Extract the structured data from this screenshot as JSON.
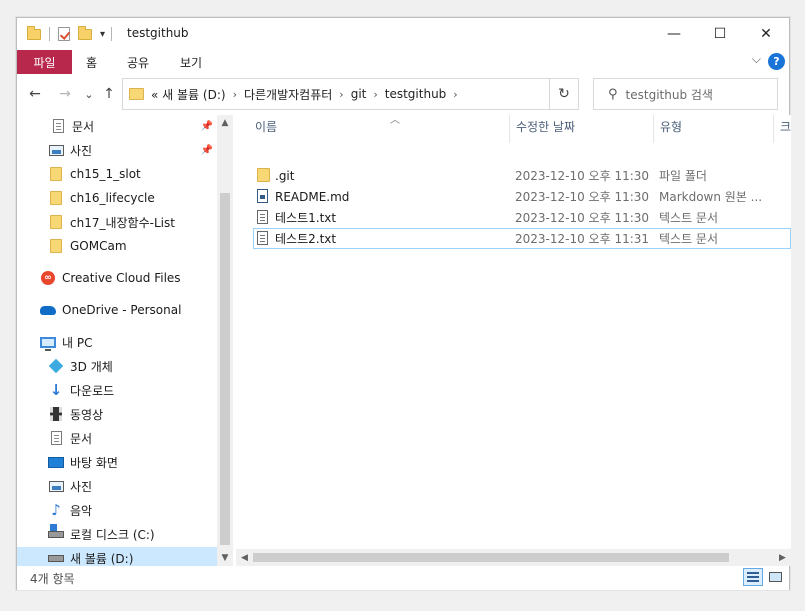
{
  "window": {
    "title": "testgithub",
    "controls": {
      "minimize": "—",
      "maximize": "☐",
      "close": "✕"
    }
  },
  "ribbon": {
    "file_tab": "파일",
    "tabs": [
      "홈",
      "공유",
      "보기"
    ],
    "collapse_chevron": "⌵",
    "help": "?"
  },
  "nav": {
    "back": "←",
    "forward": "→",
    "recent": "⌄",
    "up": "↑",
    "breadcrumb": [
      "« 새 볼륨 (D:)",
      "다른개발자컴퓨터",
      "git",
      "testgithub"
    ],
    "breadcrumb_sep": "›",
    "refresh": "↻",
    "search_placeholder": "testgithub 검색"
  },
  "sidebar": {
    "items": [
      {
        "label": "문서",
        "pinned": true,
        "icon": "document-icon"
      },
      {
        "label": "사진",
        "pinned": true,
        "icon": "pictures-icon"
      },
      {
        "label": "ch15_1_slot",
        "icon": "folder-icon"
      },
      {
        "label": "ch16_lifecycle",
        "icon": "folder-icon"
      },
      {
        "label": "ch17_내장함수-List",
        "icon": "folder-icon"
      },
      {
        "label": "GOMCam",
        "icon": "folder-icon"
      },
      {
        "label": "Creative Cloud Files",
        "icon": "creative-cloud-icon"
      },
      {
        "label": "OneDrive - Personal",
        "icon": "onedrive-icon"
      },
      {
        "label": "내 PC",
        "icon": "this-pc-icon"
      },
      {
        "label": "3D 개체",
        "icon": "3d-objects-icon"
      },
      {
        "label": "다운로드",
        "icon": "downloads-icon"
      },
      {
        "label": "동영상",
        "icon": "videos-icon"
      },
      {
        "label": "문서",
        "icon": "document-icon"
      },
      {
        "label": "바탕 화면",
        "icon": "desktop-icon"
      },
      {
        "label": "사진",
        "icon": "pictures-icon"
      },
      {
        "label": "음악",
        "icon": "music-icon"
      },
      {
        "label": "로컬 디스크 (C:)",
        "icon": "local-disk-icon"
      },
      {
        "label": "새 볼륨 (D:)",
        "icon": "drive-icon",
        "selected": true
      }
    ],
    "pin_glyph": "📌"
  },
  "columns": {
    "name": "이름",
    "modified": "수정한 날짜",
    "type": "유형",
    "size": "크"
  },
  "files": [
    {
      "name": ".git",
      "modified": "2023-12-10 오후 11:30",
      "type": "파일 폴더",
      "icon": "folder-icon"
    },
    {
      "name": "README.md",
      "modified": "2023-12-10 오후 11:30",
      "type": "Markdown 원본 ...",
      "icon": "markdown-file-icon"
    },
    {
      "name": "테스트1.txt",
      "modified": "2023-12-10 오후 11:30",
      "type": "텍스트 문서",
      "icon": "text-file-icon"
    },
    {
      "name": "테스트2.txt",
      "modified": "2023-12-10 오후 11:31",
      "type": "텍스트 문서",
      "icon": "text-file-icon",
      "selected": true
    }
  ],
  "status": {
    "item_count": "4개 항목"
  },
  "colors": {
    "file_tab": "#b8284c",
    "selection": "#cce8ff",
    "accent": "#1a73d6"
  }
}
